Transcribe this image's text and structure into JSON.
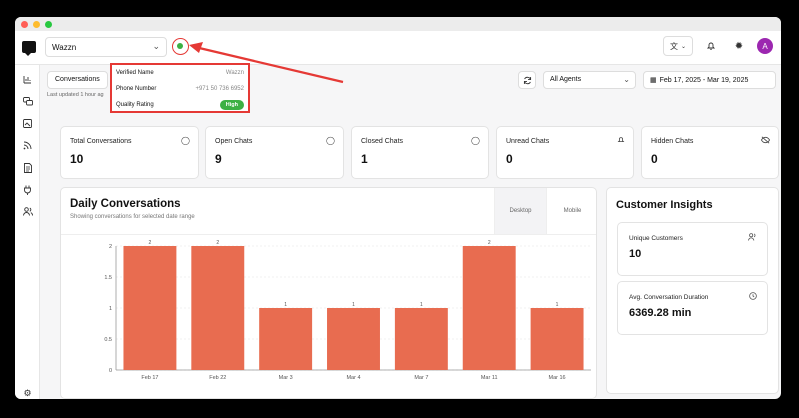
{
  "colors": {
    "bar": "#e86c50",
    "status_online": "#3cb043",
    "annotation": "#e53935",
    "avatar": "#9c27b0"
  },
  "header": {
    "workspace": "Wazzn",
    "avatar_letter": "A",
    "lang_icon": "translate-icon",
    "bell_icon": "bell-icon",
    "theme_icon": "sun-icon"
  },
  "toolbar": {
    "tab_label": "Conversations",
    "last_updated": "Last updated 1 hour ag",
    "agents_label": "All Agents",
    "date_range": "Feb 17, 2025 - Mar 19, 2025"
  },
  "popup": {
    "verified_label": "Verified Name",
    "verified_value": "Wazzn",
    "phone_label": "Phone Number",
    "phone_value": "+971 50 736 6952",
    "quality_label": "Quality Rating",
    "quality_value": "High"
  },
  "stats": [
    {
      "label": "Total Conversations",
      "value": "10",
      "icon": "chat-icon"
    },
    {
      "label": "Open Chats",
      "value": "9",
      "icon": "chat-icon"
    },
    {
      "label": "Closed Chats",
      "value": "1",
      "icon": "chat-icon"
    },
    {
      "label": "Unread Chats",
      "value": "0",
      "icon": "bell-icon"
    },
    {
      "label": "Hidden Chats",
      "value": "0",
      "icon": "eye-off-icon"
    }
  ],
  "daily": {
    "title": "Daily Conversations",
    "subtitle": "Showing conversations for selected date range",
    "tab_desktop": "Desktop",
    "tab_mobile": "Mobile"
  },
  "insights": {
    "title": "Customer Insights",
    "unique_label": "Unique Customers",
    "unique_value": "10",
    "duration_label": "Avg. Conversation Duration",
    "duration_value": "6369.28 min"
  },
  "chart_data": {
    "type": "bar",
    "categories": [
      "Feb 17",
      "Feb 22",
      "Mar 3",
      "Mar 4",
      "Mar 7",
      "Mar 11",
      "Mar 16"
    ],
    "values": [
      2,
      2,
      1,
      1,
      1,
      2,
      1
    ],
    "y_ticks": [
      "0",
      "0.5",
      "1",
      "1.5",
      "2"
    ],
    "ylim": [
      0,
      2
    ],
    "grid": true
  }
}
